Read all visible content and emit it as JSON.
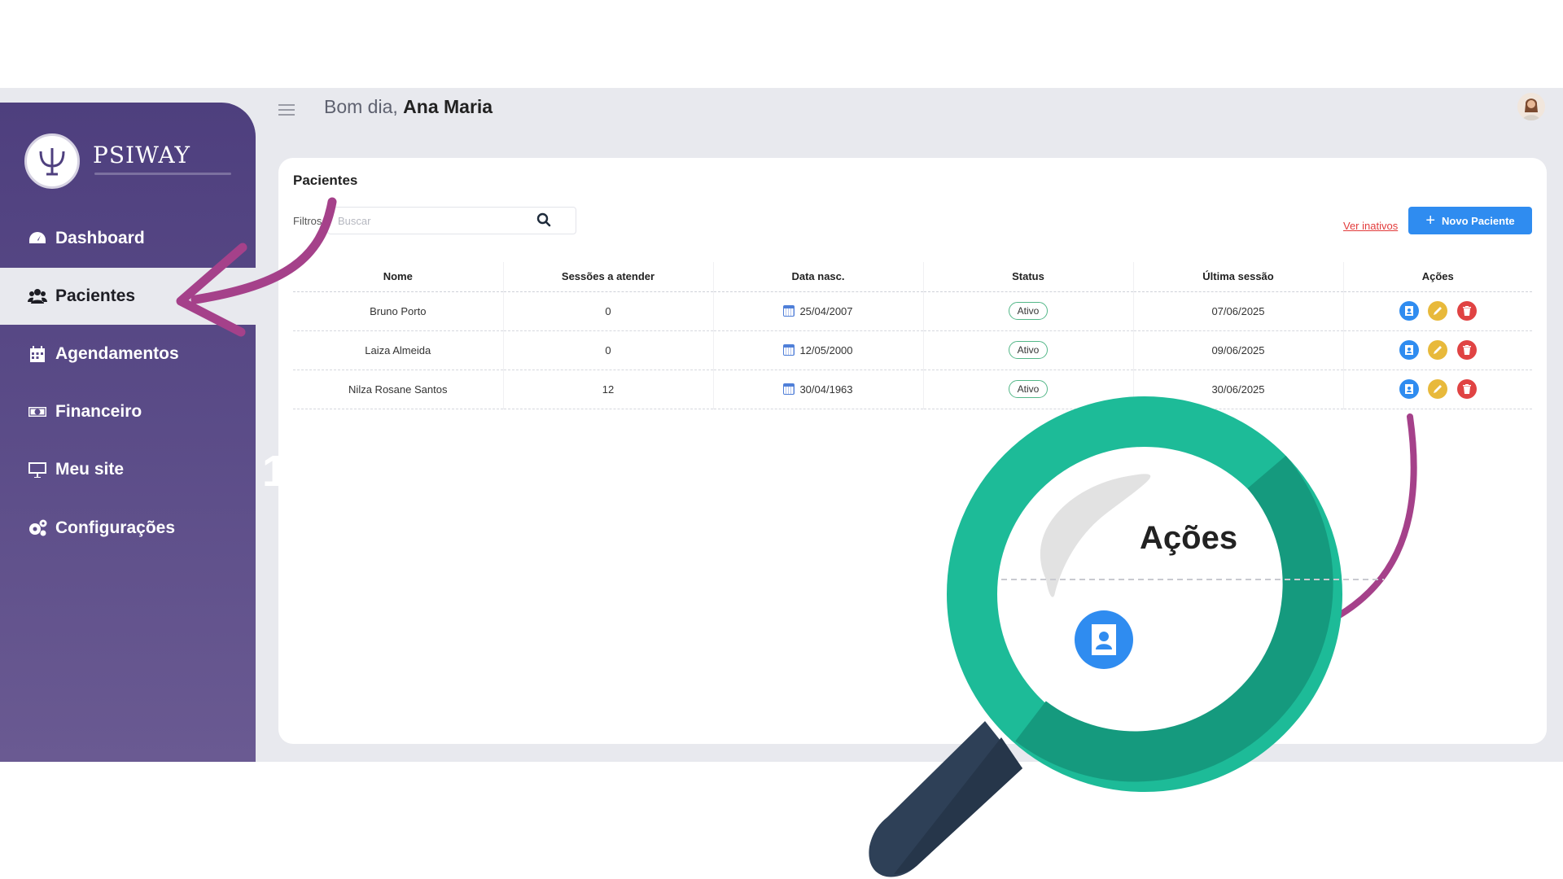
{
  "colors": {
    "sidebar_top": "#4e3f7e",
    "sidebar_bottom": "#6a5a92",
    "primary_button": "#2f8cf0",
    "link_red": "#e23b3b",
    "status_border": "#53b788",
    "magnifier_teal": "#1dbb98",
    "arrow_purple": "#a5418a"
  },
  "brand": {
    "name": "PSIWAY",
    "logo_icon": "psi-icon"
  },
  "sidebar": {
    "items": [
      {
        "label": "Dashboard",
        "icon": "dashboard-icon",
        "active": false
      },
      {
        "label": "Pacientes",
        "icon": "users-icon",
        "active": true
      },
      {
        "label": "Agendamentos",
        "icon": "calendar-icon",
        "active": false
      },
      {
        "label": "Financeiro",
        "icon": "money-icon",
        "active": false
      },
      {
        "label": "Meu site",
        "icon": "monitor-icon",
        "active": false
      },
      {
        "label": "Configurações",
        "icon": "gears-icon",
        "active": false
      }
    ]
  },
  "header": {
    "greeting": "Bom dia,",
    "user_name": "Ana Maria"
  },
  "patients": {
    "title": "Pacientes",
    "filters_label": "Filtros",
    "search_placeholder": "Buscar",
    "inactive_link": "Ver inativos",
    "new_button": "Novo Paciente",
    "columns": [
      "Nome",
      "Sessões a atender",
      "Data nasc.",
      "Status",
      "Última sessão",
      "Ações"
    ],
    "rows": [
      {
        "name": "Bruno Porto",
        "sessions": "0",
        "birth": "25/04/2007",
        "status": "Ativo",
        "last": "07/06/2025"
      },
      {
        "name": "Laiza Almeida",
        "sessions": "0",
        "birth": "12/05/2000",
        "status": "Ativo",
        "last": "09/06/2025"
      },
      {
        "name": "Nilza Rosane Santos",
        "sessions": "12",
        "birth": "30/04/1963",
        "status": "Ativo",
        "last": "30/06/2025"
      }
    ]
  },
  "overlay": {
    "step_number": "1",
    "zoom_label": "Ações"
  }
}
